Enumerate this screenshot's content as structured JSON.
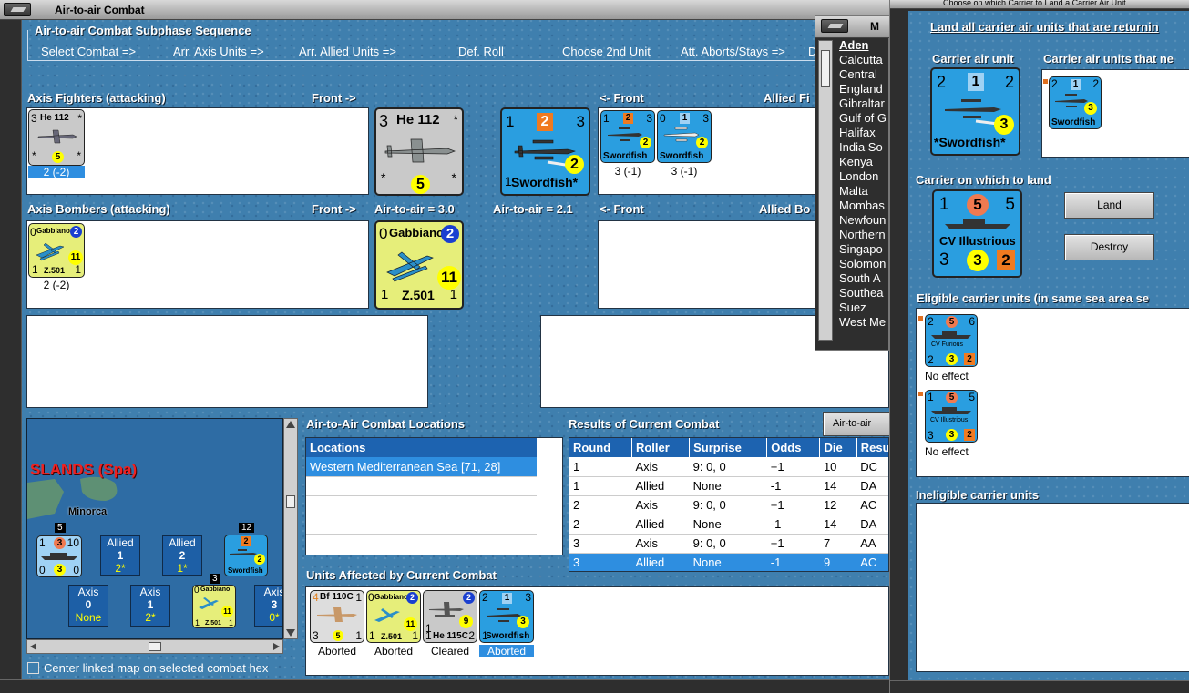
{
  "main_window": {
    "title": "Air-to-air Combat",
    "sequence_title": "Air-to-air Combat Subphase Sequence",
    "sequence_steps": [
      "Select Combat =>",
      "Arr. Axis Units =>",
      "Arr. Allied Units =>",
      "Def. Roll",
      "Choose 2nd Unit",
      "Att. Aborts/Stays =>",
      "D"
    ],
    "axis_fighters_label": "Axis Fighters (attacking)",
    "front_right": "Front ->",
    "front_left": "<- Front",
    "allied_fighters_label": "Allied Fi",
    "axis_bombers_label": "Axis Bombers (attacking)",
    "allied_bombers_label": "Allied Bo",
    "axis_air_to_air": "Air-to-air = 3.0",
    "allied_air_to_air": "Air-to-air = 2.1",
    "axis_fighter_unit": {
      "name": "He 112",
      "tl": "3",
      "tr": "*",
      "bl": "*",
      "br": "*",
      "circle": "5",
      "caption": "2 (-2)"
    },
    "axis_bomber_unit": {
      "name": "Gabbiano",
      "sub": "Z.501",
      "tl": "0",
      "circle": "2",
      "yellow": "11",
      "bl": "1",
      "br": "1",
      "caption": "2 (-2)"
    },
    "allied_front_unit": {
      "name": "Swordfish*",
      "tl": "1",
      "sq": "2",
      "tr": "3",
      "circle": "2",
      "bl": "1"
    },
    "allied_fighters": [
      {
        "name": "Swordfish",
        "tl": "1",
        "sq": "2",
        "tr": "3",
        "circle": "2",
        "caption": "3 (-1)"
      },
      {
        "name": "Swordfish",
        "tl": "0",
        "sq": "1",
        "tr": "3",
        "circle": "2",
        "caption": "3 (-1)"
      }
    ],
    "locations_title": "Air-to-Air Combat Locations",
    "locations_header": "Locations",
    "locations": [
      "Western Mediterranean Sea [71, 28]"
    ],
    "results_title": "Results of Current Combat",
    "results_tab": "Air-to-air Com",
    "results_columns": [
      "Round",
      "Roller",
      "Surprise",
      "Odds",
      "Die",
      "Resu"
    ],
    "results_rows": [
      [
        "1",
        "Axis",
        "9: 0, 0",
        "+1",
        "10",
        "DC"
      ],
      [
        "1",
        "Allied",
        "None",
        "-1",
        "14",
        "DA"
      ],
      [
        "2",
        "Axis",
        "9: 0, 0",
        "+1",
        "12",
        "AC"
      ],
      [
        "2",
        "Allied",
        "None",
        "-1",
        "14",
        "DA"
      ],
      [
        "3",
        "Axis",
        "9: 0, 0",
        "+1",
        "7",
        "AA"
      ],
      [
        "3",
        "Allied",
        "None",
        "-1",
        "9",
        "AC"
      ]
    ],
    "affected_title": "Units Affected by Current Combat",
    "affected_units": [
      {
        "name": "Bf 110C",
        "tl": "4",
        "tr": "1",
        "bl": "3",
        "circle": "5",
        "br": "1",
        "status": "Aborted"
      },
      {
        "name": "Gabbiano",
        "sub": "Z.501",
        "tl": "0",
        "circle": "2",
        "yellow": "11",
        "bl": "1",
        "br": "1",
        "status": "Aborted"
      },
      {
        "name": "He 115C",
        "tl": "1",
        "circle": "2",
        "yellow": "9",
        "bl": "1",
        "br": "2",
        "status": "Cleared"
      },
      {
        "name": "Swordfish",
        "tl": "2",
        "sq": "1",
        "tr": "3",
        "circle": "3",
        "bl": "1",
        "status": "Aborted"
      }
    ],
    "center_map_label": "Center linked map on selected combat hex",
    "map": {
      "region": "SLANDS (Spa)",
      "island": "Minorca",
      "chips": [
        {
          "side": "Allied",
          "value": "2",
          "sub": "1*"
        },
        {
          "side": "Allied",
          "value": "1",
          "sub": "2*"
        },
        {
          "side": "Axis",
          "value": "0",
          "sub": "None"
        },
        {
          "side": "Axis",
          "value": "1",
          "sub": "2*"
        },
        {
          "side": "Axis",
          "value": "3",
          "sub": "0*"
        }
      ],
      "stack_counts": [
        "5",
        "12",
        "3"
      ],
      "carrier_counter": {
        "tl": "1",
        "circle": "3",
        "tr": "10",
        "bl": "0",
        "bc": "3",
        "br": "0"
      },
      "map_swordfish": {
        "name": "Swordfish",
        "sq": "2",
        "circle": "2"
      },
      "map_gabbiano": {
        "name": "Gabbiano",
        "sub": "Z.501",
        "yellow": "11",
        "tl": "0",
        "bl": "1",
        "br": "1"
      }
    }
  },
  "middle_window": {
    "title": "M",
    "list": [
      "Aden",
      "Calcutta",
      "Central",
      "England",
      "Gibraltar",
      "Gulf of G",
      "Halifax",
      "India So",
      "Kenya",
      "London",
      "Malta",
      "Mombas",
      "Newfoun",
      "Northern",
      "Singapo",
      "Solomon",
      "South A",
      "Southea",
      "Suez",
      "West Me"
    ],
    "selected": "Aden"
  },
  "right_window": {
    "title": "Choose on which Carrier to Land a Carrier Air Unit",
    "instruction": "Land all carrier air units that are returnin",
    "carrier_air_unit_label": "Carrier air unit",
    "carrier_air_units_that_label": "Carrier air units that ne",
    "air_unit": {
      "name": "*Swordfish*",
      "tl": "2",
      "sq": "1",
      "tr": "2",
      "circle": "3"
    },
    "small_air_unit": {
      "name": "Swordfish",
      "tl": "2",
      "sq": "1",
      "tr": "2",
      "circle": "3"
    },
    "carrier_land_label": "Carrier on which to land",
    "carrier": {
      "name": "CV Illustrious",
      "tl": "1",
      "circle": "5",
      "tr": "5",
      "bl": "3",
      "yellow": "3",
      "sq": "2"
    },
    "land_button": "Land",
    "destroy_button": "Destroy",
    "eligible_label": "Eligible carrier units (in same sea area se",
    "eligible_units": [
      {
        "name": "CV Furious",
        "tl": "2",
        "circle": "5",
        "tr": "6",
        "bl": "2",
        "yellow": "3",
        "sq": "2",
        "effect": "No effect"
      },
      {
        "name": "CV Illustrious",
        "tl": "1",
        "circle": "5",
        "tr": "5",
        "bl": "3",
        "yellow": "3",
        "sq": "2",
        "effect": "No effect"
      }
    ],
    "ineligible_label": "Ineligible carrier units"
  },
  "colors": {
    "sea": "#3f7fae",
    "header_blue": "#1d63b0",
    "selection": "#2e8ee0",
    "counter_blue": "#2a9ee0",
    "counter_yellow": "#e6ee7a",
    "counter_grey": "#c9c9c9"
  },
  "icons": [
    "window-menu-icon",
    "plane-silhouette-icon",
    "seaplane-silhouette-icon",
    "carrier-ship-icon",
    "scroll-arrow-icon",
    "checkbox-icon"
  ]
}
